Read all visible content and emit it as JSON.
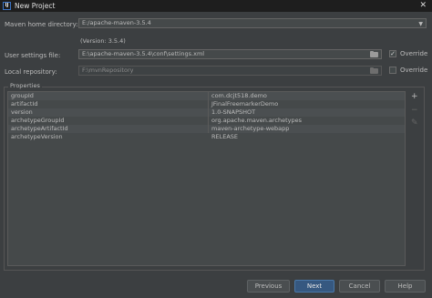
{
  "window": {
    "title": "New Project",
    "logo_text": "IJ",
    "close_glyph": "✕"
  },
  "form": {
    "maven_home": {
      "label": "Maven home directory:",
      "value": "E:/apache-maven-3.5.4",
      "version_note": "(Version: 3.5.4)"
    },
    "user_settings": {
      "label": "User settings file:",
      "value": "E:\\apache-maven-3.5.4\\conf\\settings.xml",
      "override_label": "Override",
      "override_checked": true
    },
    "local_repo": {
      "label": "Local repository:",
      "value": "F:\\mvnRepository",
      "override_label": "Override",
      "override_checked": false
    }
  },
  "properties": {
    "section_label": "Properties",
    "rows": [
      {
        "key": "groupId",
        "value": "com.dcjt518.demo"
      },
      {
        "key": "artifactId",
        "value": "JFinalFreemarkerDemo"
      },
      {
        "key": "version",
        "value": "1.0-SNAPSHOT"
      },
      {
        "key": "archetypeGroupId",
        "value": "org.apache.maven.archetypes"
      },
      {
        "key": "archetypeArtifactId",
        "value": "maven-archetype-webapp"
      },
      {
        "key": "archetypeVersion",
        "value": "RELEASE"
      }
    ],
    "tools": {
      "add": "+",
      "remove": "−",
      "edit": "✎"
    }
  },
  "buttons": {
    "previous": "Previous",
    "next": "Next",
    "cancel": "Cancel",
    "help": "Help"
  },
  "glyphs": {
    "dropdown": "▼",
    "check": "✓"
  },
  "colors": {
    "background": "#3c3f41",
    "primary_button": "#365880",
    "field": "#45494a"
  }
}
